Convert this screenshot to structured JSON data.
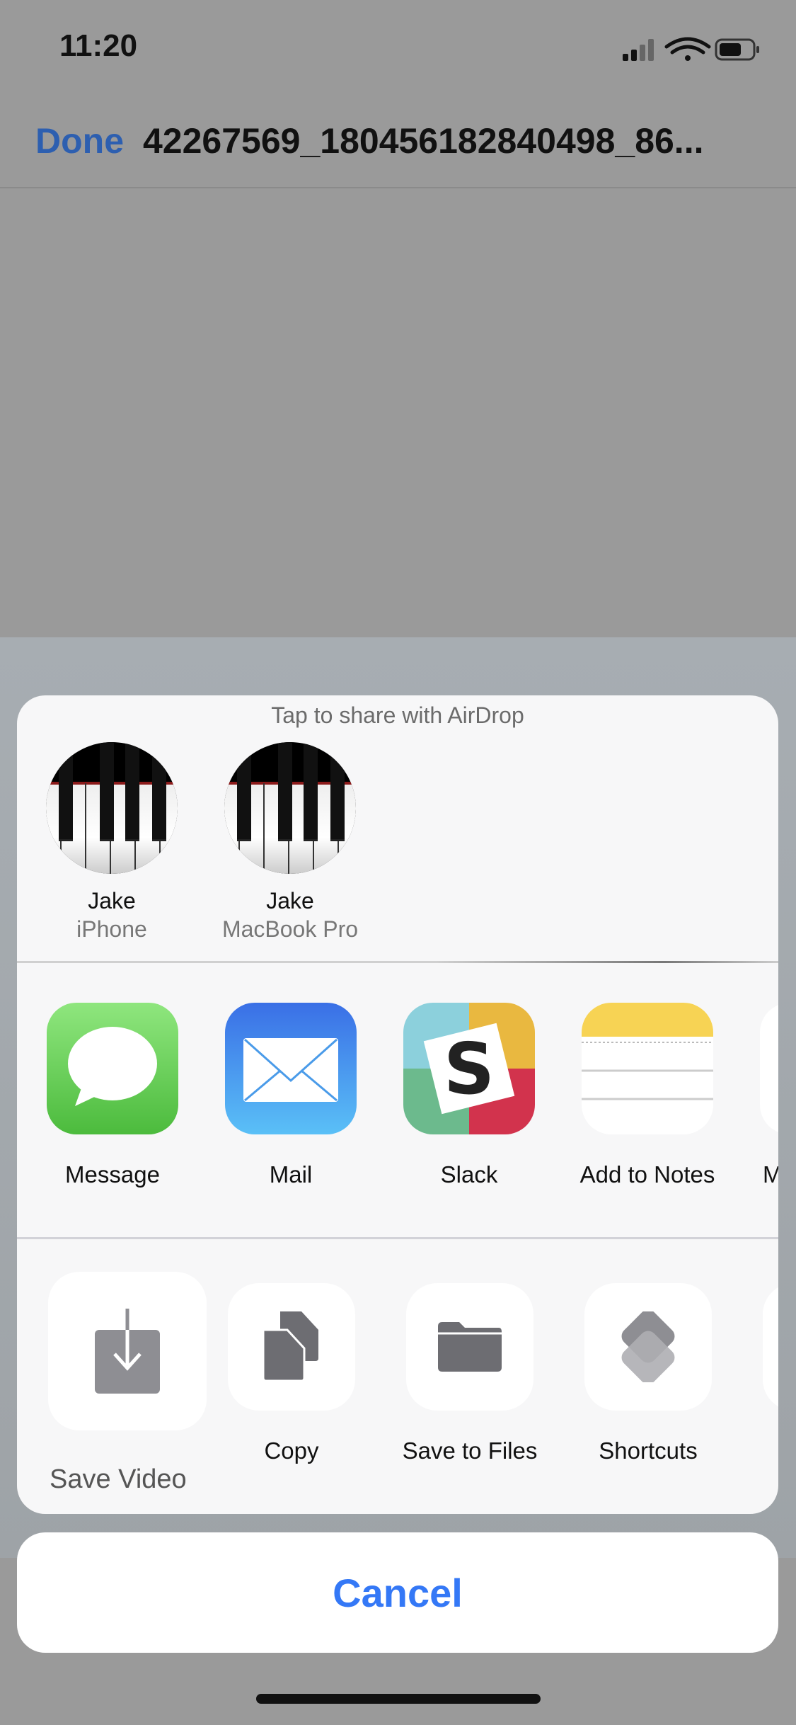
{
  "status_bar": {
    "time": "11:20",
    "icons": [
      "cellular-signal-icon",
      "wifi-icon",
      "battery-icon"
    ]
  },
  "nav": {
    "done_label": "Done",
    "title": "42267569_180456182840498_86..."
  },
  "share_sheet": {
    "airdrop_hint": "Tap to share with AirDrop",
    "airdrop_devices": [
      {
        "name": "Jake",
        "device": "iPhone"
      },
      {
        "name": "Jake",
        "device": "MacBook Pro"
      }
    ],
    "apps": [
      {
        "label": "Message",
        "icon": "messages-icon"
      },
      {
        "label": "Mail",
        "icon": "mail-icon"
      },
      {
        "label": "Slack",
        "icon": "slack-icon"
      },
      {
        "label": "Add to Notes",
        "icon": "notes-icon"
      },
      {
        "label": "M",
        "icon": "more-app-icon"
      }
    ],
    "actions": [
      {
        "label": "Save Video",
        "icon": "save-download-icon"
      },
      {
        "label": "Copy",
        "icon": "copy-icon"
      },
      {
        "label": "Save to Files",
        "icon": "folder-icon"
      },
      {
        "label": "Shortcuts",
        "icon": "shortcuts-icon"
      }
    ],
    "cancel_label": "Cancel"
  },
  "colors": {
    "accent": "#3478f6",
    "done": "#2d5fb0"
  }
}
